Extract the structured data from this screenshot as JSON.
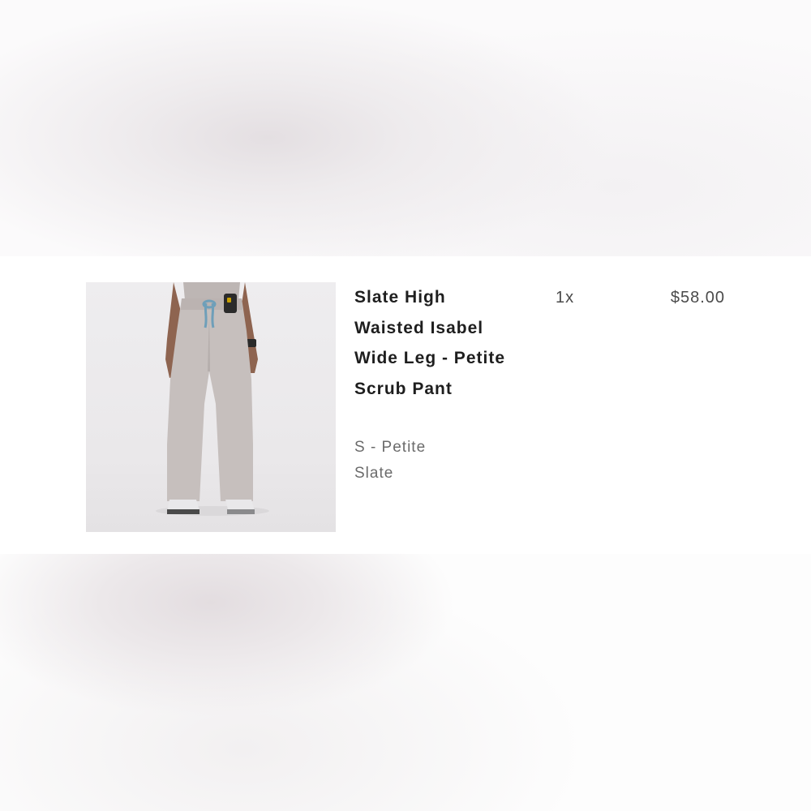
{
  "cart_item": {
    "title": "Slate High Waisted Isabel Wide Leg - Petite Scrub Pant",
    "size": "S - Petite",
    "color": "Slate",
    "quantity": "1x",
    "price": "$58.00"
  }
}
